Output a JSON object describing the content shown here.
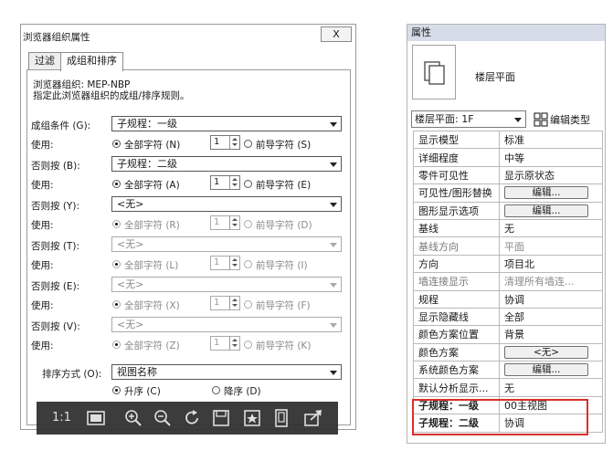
{
  "dialog": {
    "title": "浏览器组织属性",
    "close_label": "X",
    "tabs": [
      "过滤",
      "成组和排序"
    ],
    "info_line1": "浏览器组织: MEP-NBP",
    "info_line2": "指定此浏览器组织的成组/排序规则。",
    "groups": [
      {
        "label": "成组条件 (G):",
        "value": "子规程：一级",
        "usage_label": "使用:",
        "all_chars": "全部字符 (N)",
        "count": "1",
        "leading_chars": "前导字符 (S)",
        "enabled": true
      },
      {
        "label": "否则按 (B):",
        "value": "子规程：二级",
        "usage_label": "使用:",
        "all_chars": "全部字符 (A)",
        "count": "1",
        "leading_chars": "前导字符 (E)",
        "enabled": true
      },
      {
        "label": "否则按 (Y):",
        "value": "<无>",
        "usage_label": "使用:",
        "all_chars": "全部字符 (R)",
        "count": "1",
        "leading_chars": "前导字符 (D)",
        "enabled": true
      },
      {
        "label": "否则按 (T):",
        "value": "<无>",
        "usage_label": "使用:",
        "all_chars": "全部字符 (L)",
        "count": "1",
        "leading_chars": "前导字符 (I)",
        "enabled": false
      },
      {
        "label": "否则按 (E):",
        "value": "<无>",
        "usage_label": "使用:",
        "all_chars": "全部字符 (X)",
        "count": "1",
        "leading_chars": "前导字符 (F)",
        "enabled": false
      },
      {
        "label": "否则按 (V):",
        "value": "<无>",
        "usage_label": "使用:",
        "all_chars": "全部字符 (Z)",
        "count": "1",
        "leading_chars": "前导字符 (K)",
        "enabled": false
      }
    ],
    "sort_label": "排序方式 (O):",
    "sort_value": "视图名称",
    "ascending": "升序 (C)",
    "descending": "降序 (D)"
  },
  "viewer_toolbar": {
    "zoom_label": "1:1",
    "icons": [
      "fit-icon",
      "zoom-in-icon",
      "zoom-out-icon",
      "rotate-icon",
      "save-icon",
      "bookmark-icon",
      "fullscreen-icon",
      "share-icon"
    ]
  },
  "properties": {
    "title": "属性",
    "type_name": "楼层平面",
    "view_selector": "楼层平面: 1F",
    "edit_type": "编辑类型",
    "rows": [
      {
        "key": "显示模型",
        "value": "标准"
      },
      {
        "key": "详细程度",
        "value": "中等"
      },
      {
        "key": "零件可见性",
        "value": "显示原状态"
      },
      {
        "key": "可见性/图形替换",
        "value": "编辑...",
        "button": true
      },
      {
        "key": "图形显示选项",
        "value": "编辑...",
        "button": true
      },
      {
        "key": "基线",
        "value": "无"
      },
      {
        "key": "基线方向",
        "value": "平面",
        "readonly": true
      },
      {
        "key": "方向",
        "value": "项目北"
      },
      {
        "key": "墙连接显示",
        "value": "清理所有墙连...",
        "readonly": true
      },
      {
        "key": "规程",
        "value": "协调"
      },
      {
        "key": "显示隐藏线",
        "value": "全部"
      },
      {
        "key": "颜色方案位置",
        "value": "背景"
      },
      {
        "key": "颜色方案",
        "value": "<无>",
        "button": true
      },
      {
        "key": "系统颜色方案",
        "value": "编辑...",
        "button": true
      },
      {
        "key": "默认分析显示...",
        "value": "无"
      },
      {
        "key": "子规程：一级",
        "value": "00主视图",
        "highlight": true
      },
      {
        "key": "子规程：二级",
        "value": "协调",
        "highlight": true
      }
    ]
  },
  "colors": {
    "highlight_border": "#d9302c",
    "panel_header": "#d6dde8"
  }
}
